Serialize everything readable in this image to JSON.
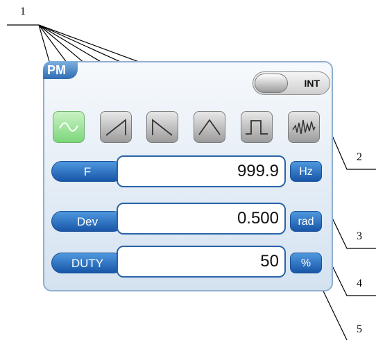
{
  "panel": {
    "title": "PM"
  },
  "source_toggle": {
    "label": "INT"
  },
  "waveforms": [
    {
      "icon": "sine-wave-icon",
      "active": true
    },
    {
      "icon": "ramp-up-icon",
      "active": false
    },
    {
      "icon": "ramp-down-icon",
      "active": false
    },
    {
      "icon": "triangle-wave-icon",
      "active": false
    },
    {
      "icon": "square-wave-icon",
      "active": false
    },
    {
      "icon": "noise-wave-icon",
      "active": false
    }
  ],
  "params": [
    {
      "label": "F",
      "value": "999.9",
      "unit": "Hz"
    },
    {
      "label": "Dev",
      "value": "0.500",
      "unit": "rad"
    },
    {
      "label": "DUTY",
      "value": "50",
      "unit": "%"
    }
  ],
  "callouts": [
    "1",
    "2",
    "3",
    "4",
    "5"
  ]
}
